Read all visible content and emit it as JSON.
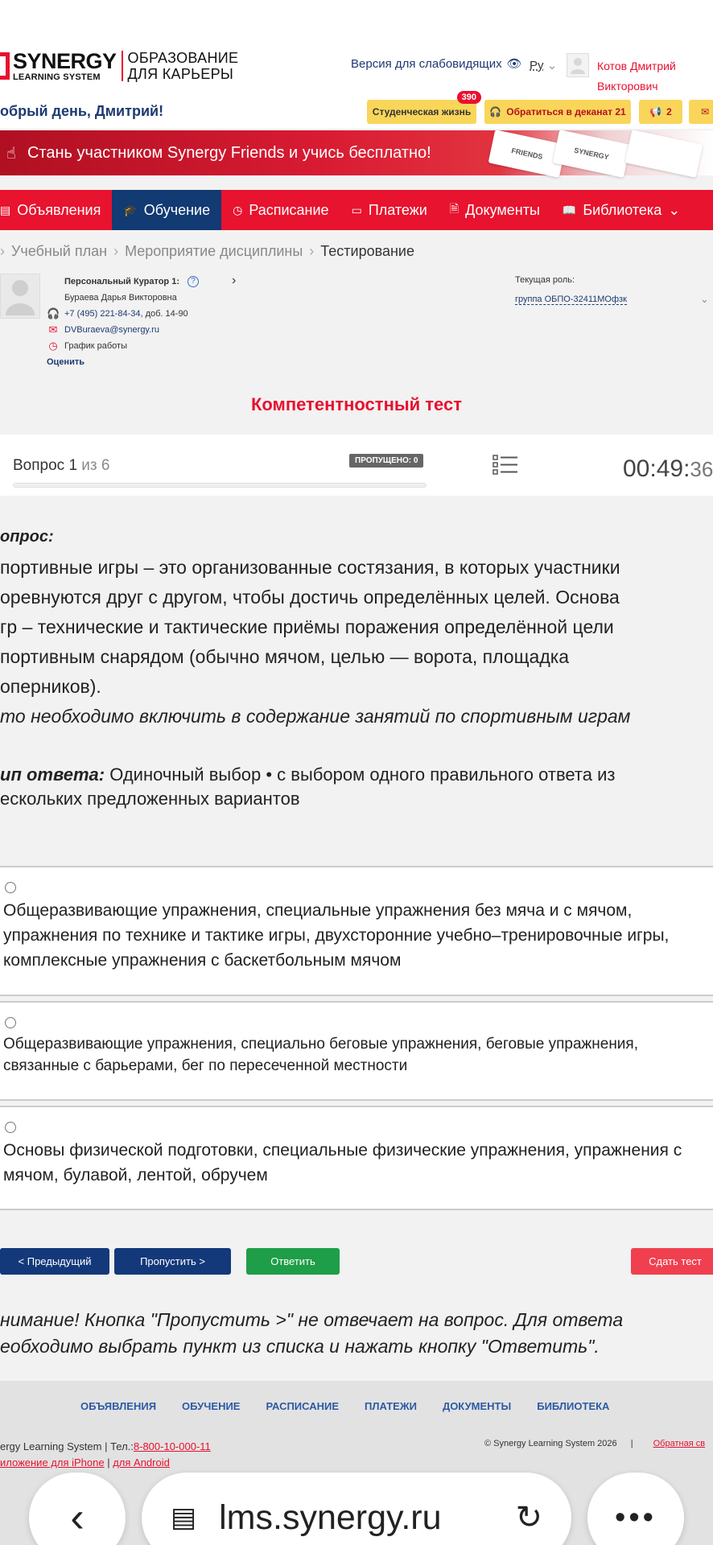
{
  "header": {
    "logo_big": "SYNERGY",
    "logo_small": "LEARNING SYSTEM",
    "logo_slogan_line1": "ОБРАЗОВАНИЕ",
    "logo_slogan_line2": "ДЛЯ КАРЬЕРЫ",
    "vision_link": "Версия для слабовидящих",
    "language": "Ру",
    "user_name_line1": "Котов Дмитрий",
    "user_name_line2": "Викторович",
    "greeting": "обрый день, Дмитрий!",
    "student_life": "Студенческая жизнь",
    "student_life_badge": "390",
    "dean_contact": "Обратиться в деканат 21",
    "notifications": "2"
  },
  "banner": {
    "text": "Стань участником Synergy Friends и учись бесплатно!",
    "card1": "FRIENDS",
    "card2": "SYNERGY"
  },
  "nav": {
    "items": [
      "Объявления",
      "Обучение",
      "Расписание",
      "Платежи",
      "Документы",
      "Библиотека"
    ],
    "active_index": 1
  },
  "breadcrumb": {
    "items": [
      "Учебный план",
      "Мероприятие дисциплины",
      "Тестирование"
    ]
  },
  "curator": {
    "title": "Персональный Куратор 1:",
    "name": "Бураева Дарья Викторовна",
    "phone": "+7 (495) 221-84-34",
    "ext": ", доб. 14-90",
    "email": "DVBuraeva@synergy.ru",
    "schedule": "График работы",
    "rate": "Оценить"
  },
  "role": {
    "label": "Текущая роль:",
    "value": "группа ОБПО-32411МОфзк"
  },
  "test": {
    "title": "Компетентностный тест",
    "question_prefix": "Вопрос ",
    "question_number": "1",
    "question_of": " из 6",
    "skipped": "ПРОПУЩЕНО: 0",
    "progress": 0,
    "timer_main": "00:49:",
    "timer_sec": "36"
  },
  "question": {
    "label": "опрос:",
    "text": "портивные игры – это организованные состязания, в которых участники\nоревнуются друг с другом, чтобы достичь определённых целей. Основа\nгр – технические и тактические приёмы поражения определённой цели\nпортивным снарядом (обычно мячом, целью — ворота, площадка\nоперников).",
    "ask": "то необходимо включить в содержание занятий по спортивным играм",
    "type_label": "ип ответа:",
    "type_value": " Одиночный выбор • с выбором одного правильного ответа из\nескольких предложенных вариантов"
  },
  "answers": [
    "Общеразвивающие упражнения, специальные упражнения без мяча и с мячом, упражнения по технике и тактике игры, двухсторонние учебно–тренировочные игры, комплексные упражнения с баскетбольным мячом",
    "Общеразвивающие упражнения, специально беговые упражнения, беговые упражнения, связанные с барьерами, бег по пересеченной местности",
    "Основы физической подготовки, специальные физические упражнения, упражнения с мячом, булавой, лентой, обручем"
  ],
  "buttons": {
    "prev": "< Предыдущий",
    "skip": "Пропустить >",
    "answer": "Ответить",
    "submit": "Сдать тест"
  },
  "warning": "нимание! Кнопка \"Пропустить >\" не отвечает на вопрос. Для ответа\nеобходимо выбрать пункт из списка и нажать кнопку \"Ответить\".",
  "footer": {
    "nav": [
      "ОБЪЯВЛЕНИЯ",
      "ОБУЧЕНИЕ",
      "РАСПИСАНИЕ",
      "ПЛАТЕЖИ",
      "ДОКУМЕНТЫ",
      "БИБЛИОТЕКА"
    ],
    "company": "ergy Learning System",
    "phone_label": "Тел.:",
    "phone": "8-800-10-000-11",
    "app_iphone": "иложение для iPhone",
    "app_android": "для Android",
    "copyright": "© Synergy Learning System 2026",
    "feedback": "Обратная св"
  },
  "browser": {
    "url": "lms.synergy.ru"
  },
  "colors": {
    "brand_red": "#e8132e",
    "brand_blue": "#123a73",
    "answer_green": "#1e9e48"
  }
}
